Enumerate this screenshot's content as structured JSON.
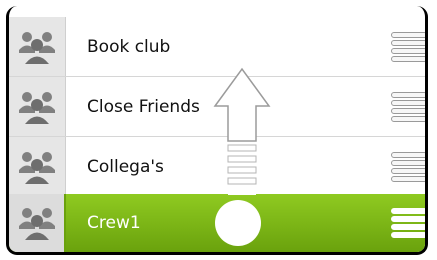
{
  "groups": [
    {
      "label": "Book club",
      "selected": false
    },
    {
      "label": "Close Friends",
      "selected": false
    },
    {
      "label": "Collega's",
      "selected": false
    },
    {
      "label": "Crew1",
      "selected": true
    }
  ],
  "icons": {
    "group_avatar": "people-group-icon",
    "drag_handle": "drag-handle-icon",
    "drag_hint": "drag-up-arrow-icon"
  },
  "colors": {
    "selected_row": "#7ab516",
    "avatar_gray": "#777777"
  }
}
